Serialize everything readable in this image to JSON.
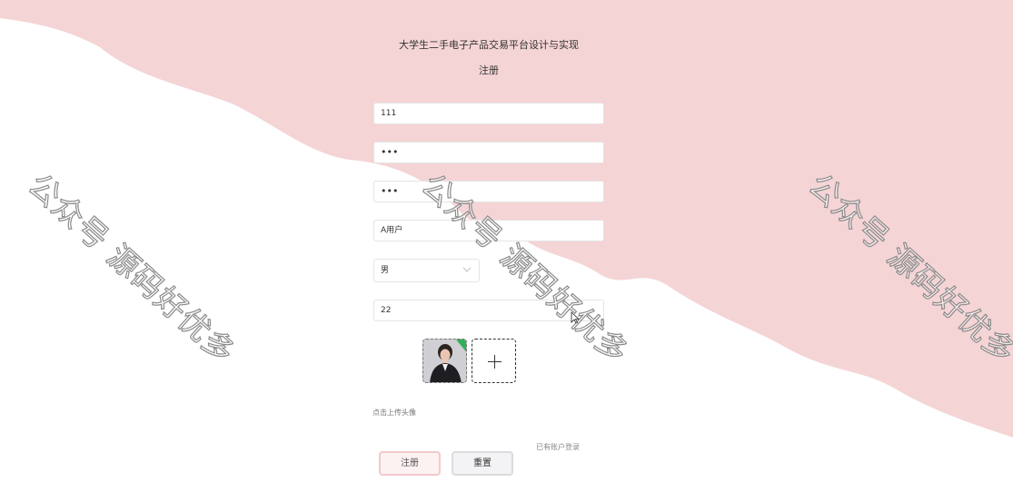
{
  "app": {
    "title": "大学生二手电子产品交易平台设计与实现",
    "subtitle": "注册"
  },
  "form": {
    "account_value": "111",
    "password_value": "•••",
    "confirm_password_value": "•••",
    "name_value": "A用户",
    "gender": {
      "selected": "男"
    },
    "age_value": "22",
    "avatar_hint": "点击上传头像",
    "login_link": "已有账户登录"
  },
  "buttons": {
    "register": "注册",
    "reset": "重置"
  },
  "watermark": {
    "text": "公众号 源码好优多"
  },
  "colors": {
    "background_wave": "#f5d4d6",
    "background": "#ffffff",
    "register_button_border": "#f4c9cc",
    "reset_button_border": "#dcdcdf"
  }
}
